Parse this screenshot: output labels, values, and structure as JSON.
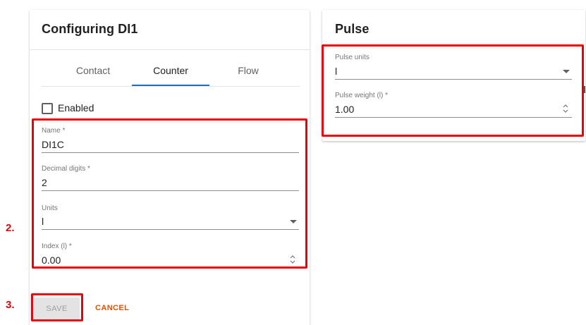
{
  "left_card": {
    "title": "Configuring DI1",
    "tabs": [
      {
        "label": "Contact"
      },
      {
        "label": "Counter"
      },
      {
        "label": "Flow"
      }
    ],
    "active_tab": "Counter",
    "enabled": {
      "label": "Enabled",
      "checked": false
    },
    "fields": {
      "name": {
        "label": "Name *",
        "value": "DI1C"
      },
      "decimal_digits": {
        "label": "Decimal digits *",
        "value": "2"
      },
      "units": {
        "label": "Units",
        "value": "l"
      },
      "index": {
        "label": "Index (l) *",
        "value": "0.00"
      }
    },
    "buttons": {
      "save": "SAVE",
      "cancel": "CANCEL"
    }
  },
  "right_card": {
    "title": "Pulse",
    "fields": {
      "pulse_units": {
        "label": "Pulse units",
        "value": "l"
      },
      "pulse_weight": {
        "label": "Pulse weight (l) *",
        "value": "1.00"
      }
    }
  },
  "annotations": {
    "step2": "2.",
    "step3": "3."
  },
  "colors": {
    "highlight": "#e8000b",
    "tab_ink": "#1e6fb4",
    "cancel": "#e65100"
  }
}
